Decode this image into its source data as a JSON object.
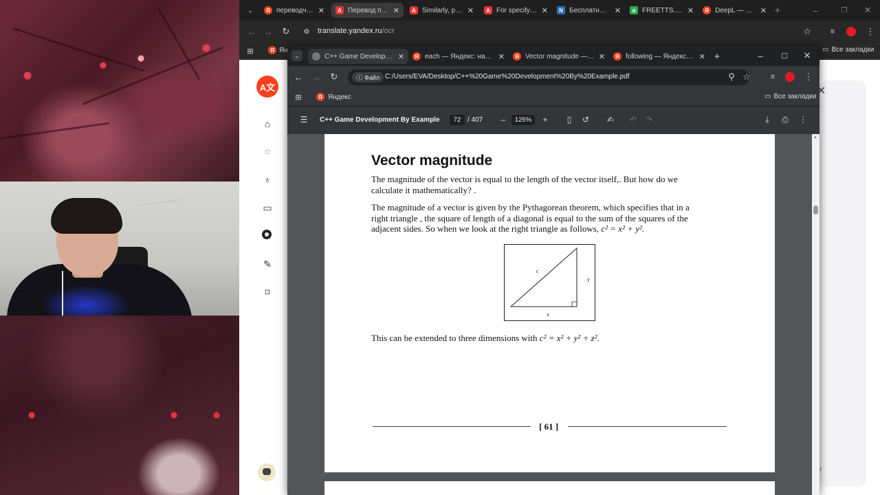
{
  "outer_tabs": [
    {
      "label": "переводчик г",
      "icon": "yandex-icon"
    },
    {
      "label": "Перевод по ф",
      "icon": "translate-icon"
    },
    {
      "label": "Similarly, poin",
      "icon": "translate-icon"
    },
    {
      "label": "For specifying",
      "icon": "translate-icon"
    },
    {
      "label": "Бесплатный с",
      "icon": "n-icon"
    },
    {
      "label": "FREETTS.RU -",
      "icon": "audio-icon"
    },
    {
      "label": "DeepL — Янд",
      "icon": "yandex-icon"
    }
  ],
  "outer_address": {
    "host": "translate.yandex.ru",
    "path": "/ocr"
  },
  "outer_bookmarks": {
    "first": "Янд",
    "all": "Все закладки"
  },
  "inner_tabs": [
    {
      "label": "C++ Game Developmen",
      "icon": "globe-icon"
    },
    {
      "label": "each — Яндекс: нашлос",
      "icon": "yandex-icon"
    },
    {
      "label": "Vector magnitude — Ян",
      "icon": "yandex-icon"
    },
    {
      "label": "following — Яндекс: на",
      "icon": "yandex-icon"
    }
  ],
  "inner_address": {
    "chip": "Файл",
    "path": "C:/Users/EVA/Desktop/C++%20Game%20Development%20By%20Example.pdf"
  },
  "inner_bookmarks": {
    "yandex": "Яндекс",
    "all": "Все закладки"
  },
  "pdf": {
    "title": "C++ Game Development By Example",
    "page": "72",
    "total": "/ 407",
    "zoom": "125%"
  },
  "doc": {
    "heading": "Vector magnitude",
    "p1_line1": "The magnitude of the vector is equal to the length of the vector itself,. But how do we",
    "p1_line2": "calculate it mathematically? .",
    "p2_line1": "The magnitude of a vector is given by the Pythagorean theorem, which specifies that in a",
    "p2_line2": "right triangle , the square of length of a diagonal is equal to the sum of the squares of the",
    "p2_line3": "adjacent sides. So when we look at the right triangle as follows,",
    "formula_2d": "c² = x² + y².",
    "fig_c": "c",
    "fig_x": "x",
    "fig_y": "y",
    "p3": "This can be extended to three dimensions with",
    "formula_3d": "c² = x² + y² + z².",
    "page_number": "[ 61 ]"
  },
  "right_panel": {
    "partial_text": "ke"
  }
}
